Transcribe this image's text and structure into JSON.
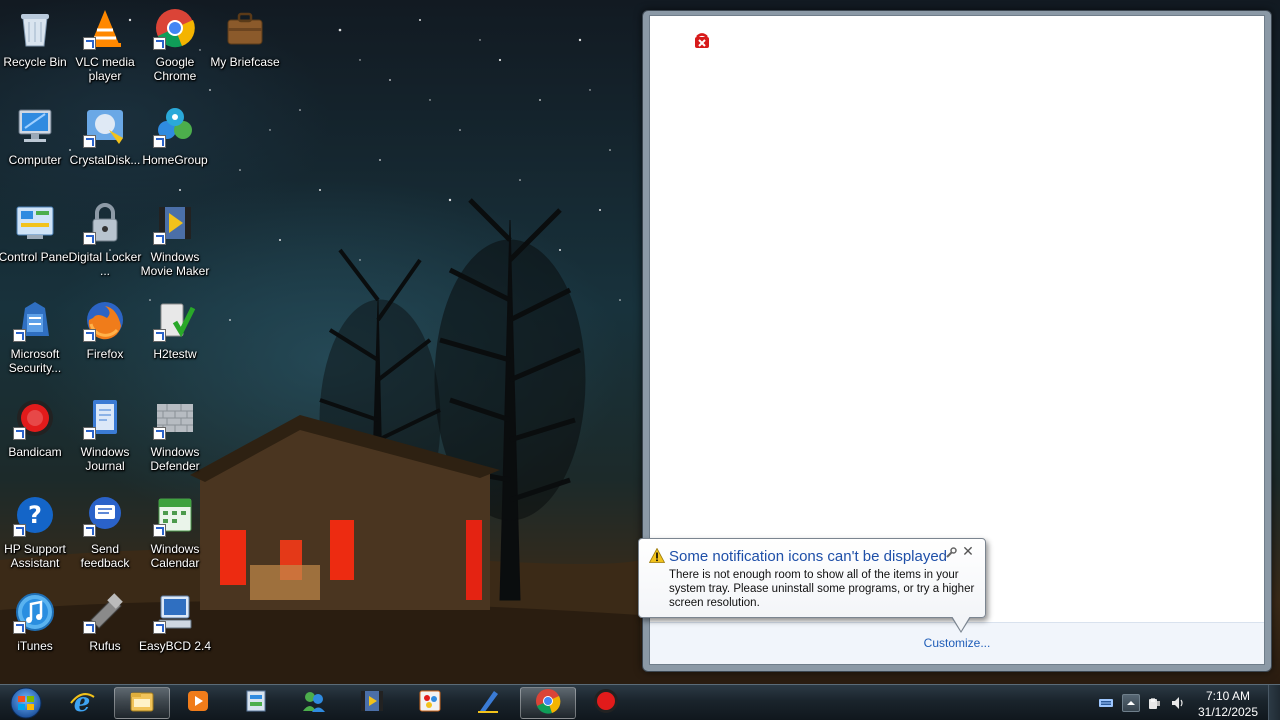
{
  "desktop": {
    "icons": [
      {
        "label": "Recycle Bin",
        "icon": "recycle-bin-icon"
      },
      {
        "label": "VLC media player",
        "icon": "vlc-icon"
      },
      {
        "label": "Google Chrome",
        "icon": "chrome-icon"
      },
      {
        "label": "My Briefcase",
        "icon": "briefcase-icon"
      },
      {
        "label": "Computer",
        "icon": "computer-icon"
      },
      {
        "label": "CrystalDisk...",
        "icon": "crystaldisk-icon"
      },
      {
        "label": "HomeGroup",
        "icon": "homegroup-icon"
      },
      {
        "label": "Control Panel",
        "icon": "control-panel-icon"
      },
      {
        "label": "Digital Locker ...",
        "icon": "digital-locker-icon"
      },
      {
        "label": "Windows Movie Maker",
        "icon": "movie-maker-icon"
      },
      {
        "label": "Microsoft Security...",
        "icon": "security-essentials-icon"
      },
      {
        "label": "Firefox",
        "icon": "firefox-icon"
      },
      {
        "label": "H2testw",
        "icon": "h2testw-icon"
      },
      {
        "label": "Bandicam",
        "icon": "bandicam-icon"
      },
      {
        "label": "Windows Journal",
        "icon": "windows-journal-icon"
      },
      {
        "label": "Windows Defender",
        "icon": "windows-defender-icon"
      },
      {
        "label": "HP Support Assistant",
        "icon": "hp-support-icon"
      },
      {
        "label": "Send feedback",
        "icon": "send-feedback-icon"
      },
      {
        "label": "Windows Calendar",
        "icon": "windows-calendar-icon"
      },
      {
        "label": "iTunes",
        "icon": "itunes-icon"
      },
      {
        "label": "Rufus",
        "icon": "rufus-icon"
      },
      {
        "label": "EasyBCD 2.4",
        "icon": "easybcd-icon"
      }
    ]
  },
  "tray_overflow": {
    "customize_label": "Customize..."
  },
  "balloon": {
    "title": "Some notification icons can't be displayed",
    "body": "There is not enough room to show all of the items in your system tray. Please uninstall some programs, or try a higher screen resolution."
  },
  "taskbar": {
    "items": [
      {
        "name": "internet-explorer",
        "running": false
      },
      {
        "name": "windows-explorer",
        "running": true
      },
      {
        "name": "media-player",
        "running": false
      },
      {
        "name": "control-center",
        "running": false
      },
      {
        "name": "windows-live-messenger",
        "running": false
      },
      {
        "name": "movie-maker",
        "running": false
      },
      {
        "name": "paint",
        "running": false
      },
      {
        "name": "pen-tool",
        "running": false
      },
      {
        "name": "google-chrome",
        "running": true
      },
      {
        "name": "bandicam",
        "running": false
      }
    ],
    "clock_time": "7:10 AM",
    "clock_date": "31/12/2025"
  },
  "colors": {
    "link": "#1f5db8",
    "balloon_title": "#1e4fa8",
    "warning": "#f2c21b"
  }
}
